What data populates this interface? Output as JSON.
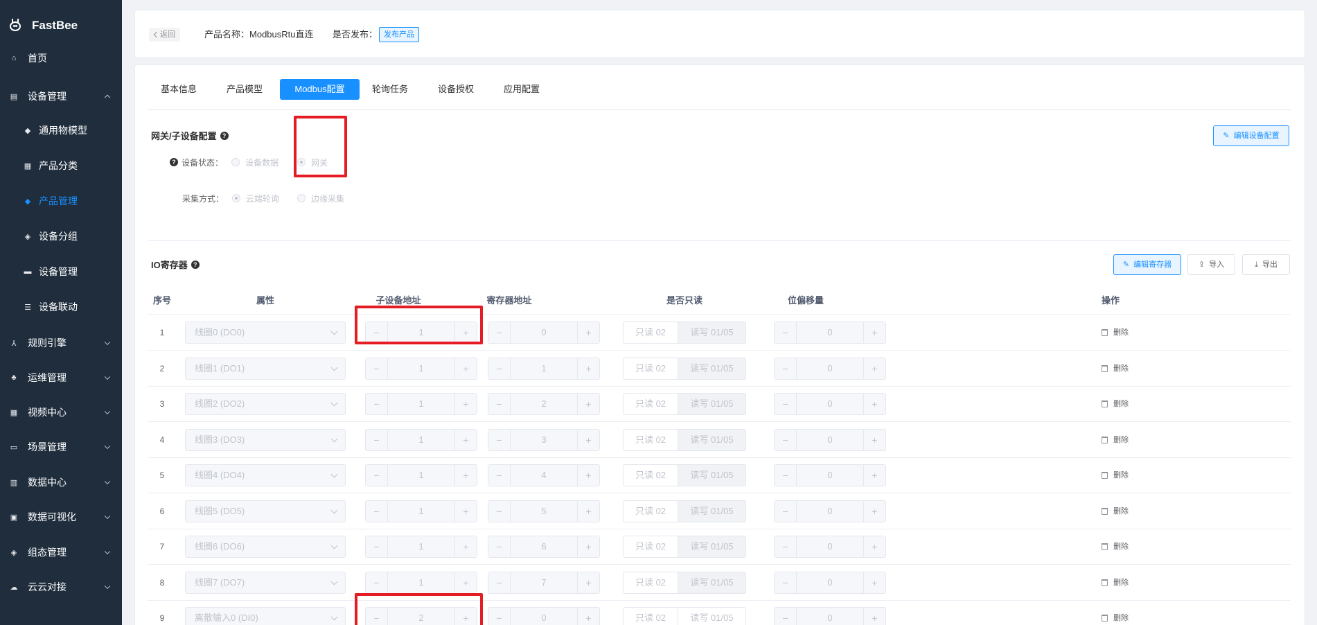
{
  "sidebar": {
    "logo_text": "FastBee",
    "items": [
      {
        "label": "首页",
        "icon": "home-icon",
        "glyph": "⌂"
      },
      {
        "label": "设备管理",
        "icon": "device-icon",
        "glyph": "▤"
      },
      {
        "label": "通用物模型",
        "icon": "cube-icon",
        "glyph": "◆"
      },
      {
        "label": "产品分类",
        "icon": "grid-icon",
        "glyph": "▦"
      },
      {
        "label": "产品管理",
        "icon": "product-icon",
        "glyph": "◆"
      },
      {
        "label": "设备分组",
        "icon": "layers-icon",
        "glyph": "◈"
      },
      {
        "label": "设备管理",
        "icon": "server-icon",
        "glyph": "▬"
      },
      {
        "label": "设备联动",
        "icon": "list-icon",
        "glyph": "☰"
      },
      {
        "label": "规则引擎",
        "icon": "rule-icon",
        "glyph": "⅄"
      },
      {
        "label": "运维管理",
        "icon": "tree-icon",
        "glyph": "♣"
      },
      {
        "label": "视频中心",
        "icon": "video-icon",
        "glyph": "▦"
      },
      {
        "label": "场景管理",
        "icon": "scene-icon",
        "glyph": "▭"
      },
      {
        "label": "数据中心",
        "icon": "chart-icon",
        "glyph": "▥"
      },
      {
        "label": "数据可视化",
        "icon": "monitor-icon",
        "glyph": "▣"
      },
      {
        "label": "组态管理",
        "icon": "stack-icon",
        "glyph": "◈"
      },
      {
        "label": "云云对接",
        "icon": "cloud-icon",
        "glyph": "☁"
      }
    ]
  },
  "info": {
    "back_label": "返回",
    "product_name_label": "产品名称：",
    "product_name": "ModbusRtu直连",
    "publish_label": "是否发布：",
    "publish_button": "发布产品"
  },
  "tabs": [
    "基本信息",
    "产品模型",
    "Modbus配置",
    "轮询任务",
    "设备授权",
    "应用配置"
  ],
  "gateway": {
    "title": "网关/子设备配置",
    "edit_button": "编辑设备配置",
    "status_label": "设备状态：",
    "status_options": [
      "设备数据",
      "网关"
    ],
    "collect_label": "采集方式：",
    "collect_options": [
      "云端轮询",
      "边缘采集"
    ]
  },
  "io": {
    "title": "IO寄存器",
    "edit_button": "编辑寄存器",
    "import_button": "导入",
    "export_button": "导出",
    "columns": [
      "序号",
      "属性",
      "子设备地址",
      "寄存器地址",
      "是否只读",
      "位偏移量",
      "操作"
    ],
    "read_only_label": "只读 02",
    "read_write_label": "读写 01/05",
    "delete_label": "删除",
    "rows": [
      {
        "idx": "1",
        "attr": "线圈0 (DO0)",
        "sub_addr": "1",
        "reg_addr": "0",
        "offset": "0"
      },
      {
        "idx": "2",
        "attr": "线圈1 (DO1)",
        "sub_addr": "1",
        "reg_addr": "1",
        "offset": "0"
      },
      {
        "idx": "3",
        "attr": "线圈2 (DO2)",
        "sub_addr": "1",
        "reg_addr": "2",
        "offset": "0"
      },
      {
        "idx": "4",
        "attr": "线圈3 (DO3)",
        "sub_addr": "1",
        "reg_addr": "3",
        "offset": "0"
      },
      {
        "idx": "5",
        "attr": "线圈4 (DO4)",
        "sub_addr": "1",
        "reg_addr": "4",
        "offset": "0"
      },
      {
        "idx": "6",
        "attr": "线圈5 (DO5)",
        "sub_addr": "1",
        "reg_addr": "5",
        "offset": "0"
      },
      {
        "idx": "7",
        "attr": "线圈6 (DO6)",
        "sub_addr": "1",
        "reg_addr": "6",
        "offset": "0"
      },
      {
        "idx": "8",
        "attr": "线圈7 (DO7)",
        "sub_addr": "1",
        "reg_addr": "7",
        "offset": "0"
      },
      {
        "idx": "9",
        "attr": "离散输入0 (DI0)",
        "sub_addr": "2",
        "reg_addr": "0",
        "offset": "0"
      }
    ]
  },
  "colors": {
    "accent": "#1890ff",
    "sidebar_bg": "#1f2d3d",
    "highlight": "#e51c23"
  }
}
